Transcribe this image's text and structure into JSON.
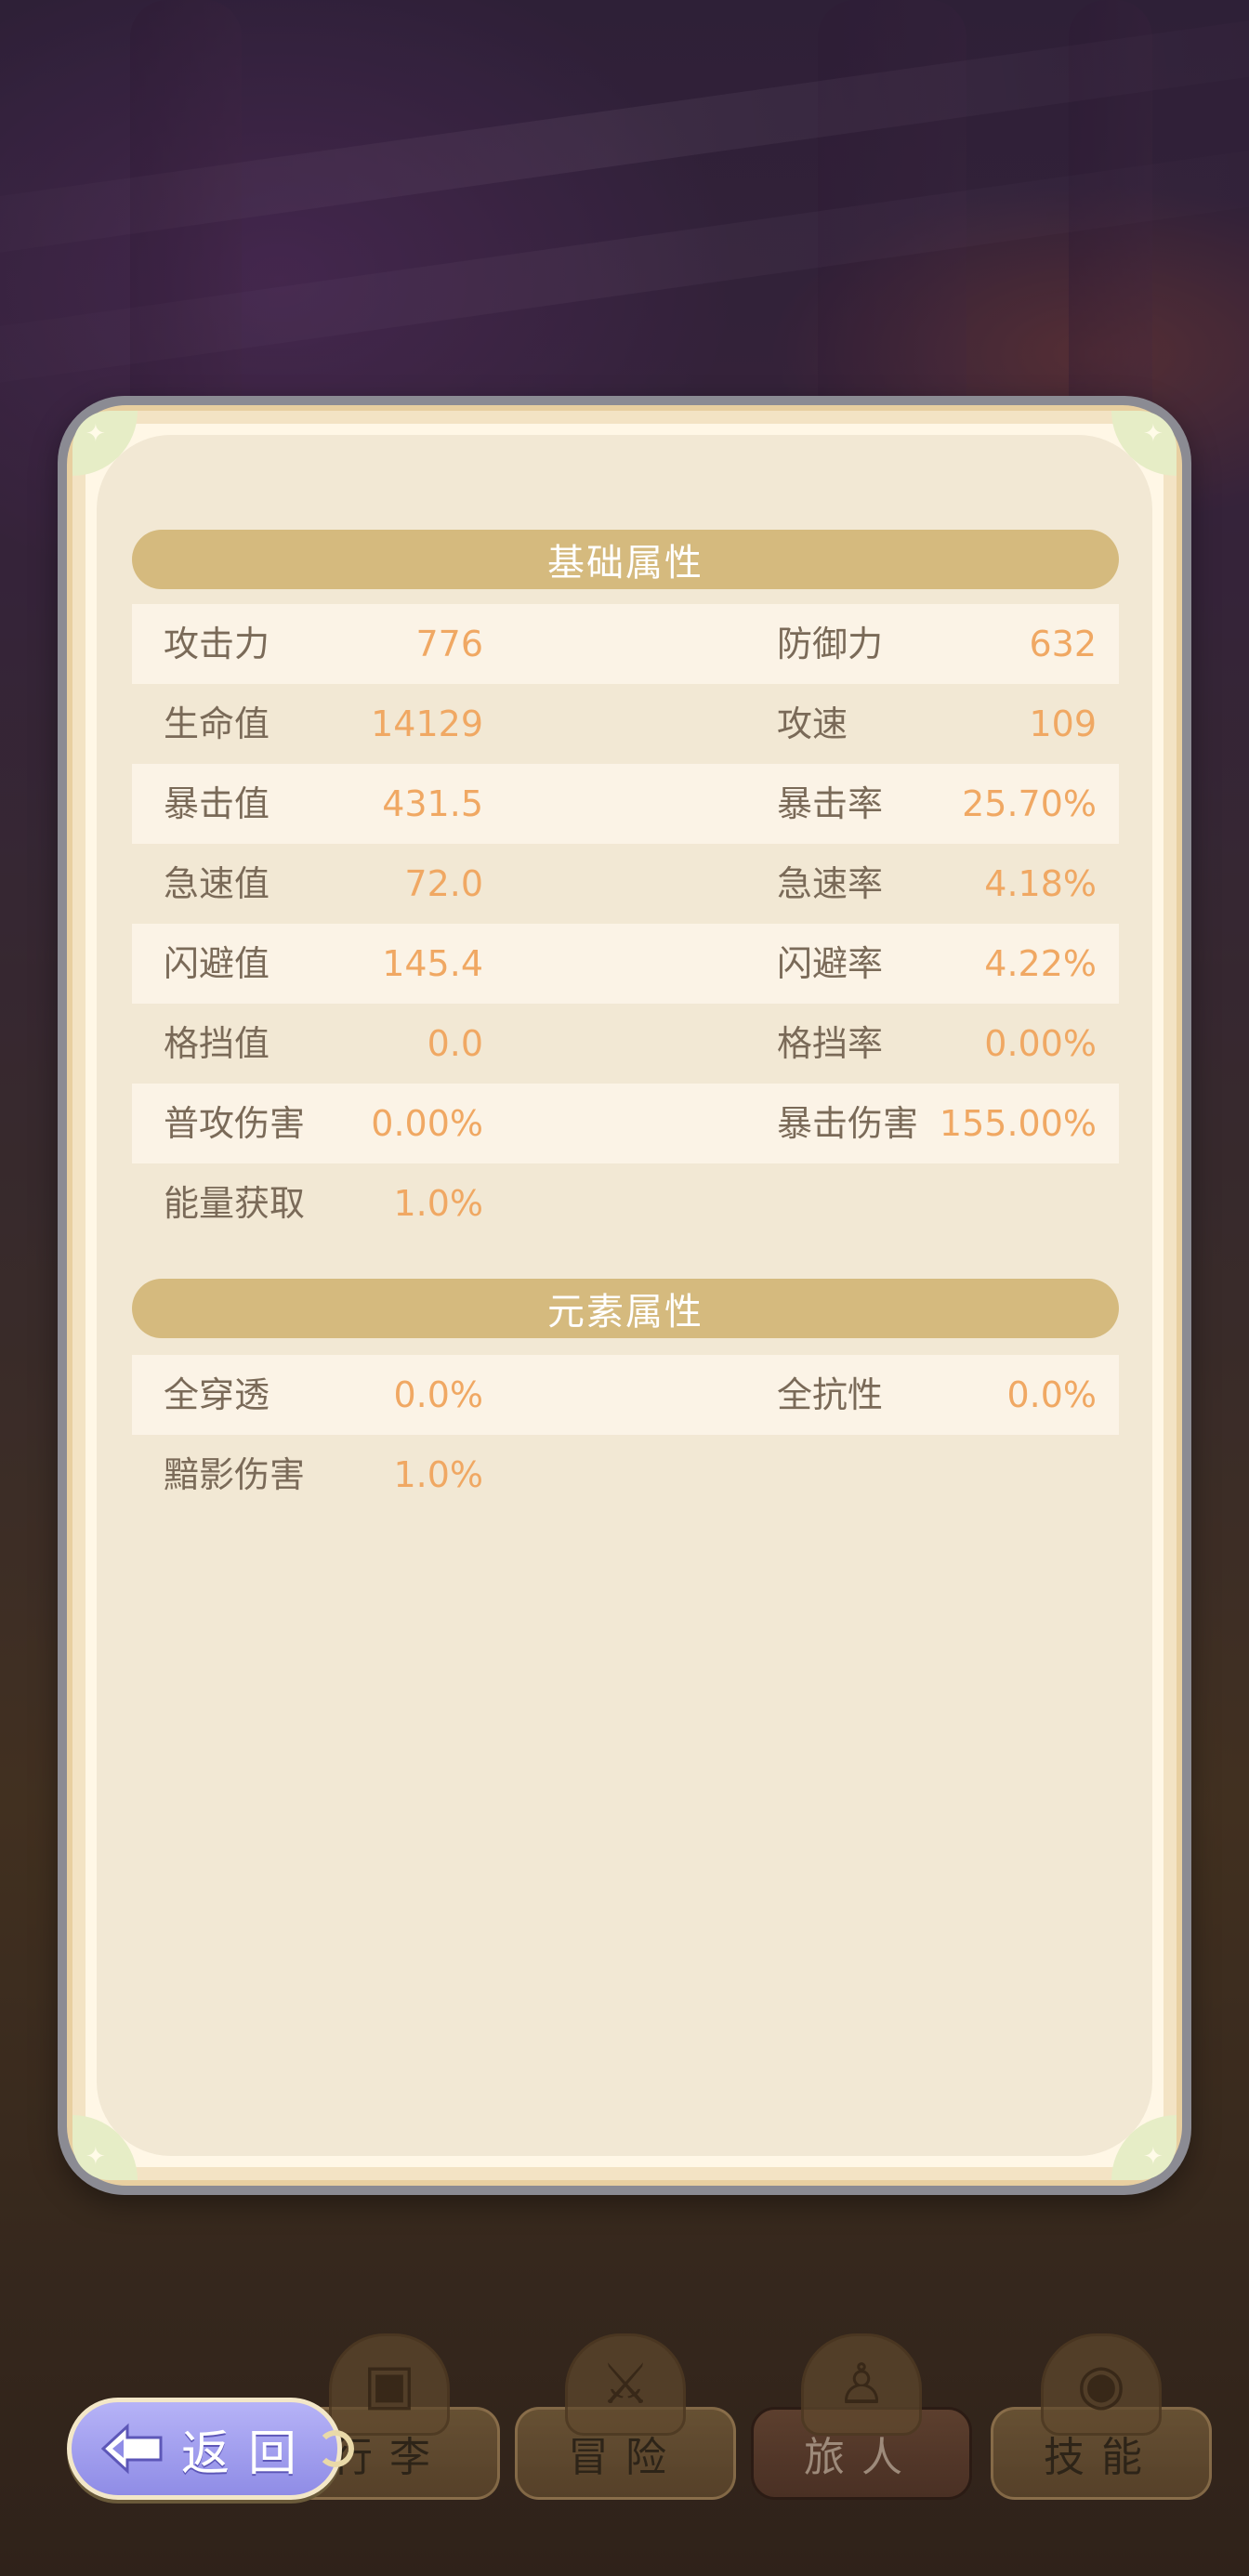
{
  "panel": {
    "sections": [
      {
        "title": "基础属性",
        "rows": [
          {
            "label1": "攻击力",
            "value1": "776",
            "label2": "防御力",
            "value2": "632"
          },
          {
            "label1": "生命值",
            "value1": "14129",
            "label2": "攻速",
            "value2": "109"
          },
          {
            "label1": "暴击值",
            "value1": "431.5",
            "label2": "暴击率",
            "value2": "25.70%"
          },
          {
            "label1": "急速值",
            "value1": "72.0",
            "label2": "急速率",
            "value2": "4.18%"
          },
          {
            "label1": "闪避值",
            "value1": "145.4",
            "label2": "闪避率",
            "value2": "4.22%"
          },
          {
            "label1": "格挡值",
            "value1": "0.0",
            "label2": "格挡率",
            "value2": "0.00%"
          },
          {
            "label1": "普攻伤害",
            "value1": "0.00%",
            "label2": "暴击伤害",
            "value2": "155.00%"
          },
          {
            "label1": "能量获取",
            "value1": "1.0%",
            "label2": "",
            "value2": ""
          }
        ]
      },
      {
        "title": "元素属性",
        "rows": [
          {
            "label1": "全穿透",
            "value1": "0.0%",
            "label2": "全抗性",
            "value2": "0.0%"
          },
          {
            "label1": "黯影伤害",
            "value1": "1.0%",
            "label2": "",
            "value2": ""
          }
        ]
      }
    ]
  },
  "bottom_nav": {
    "tabs": [
      {
        "label": "行李",
        "icon": "chest-icon"
      },
      {
        "label": "冒险",
        "icon": "crossed-swords-icon"
      },
      {
        "label": "旅人",
        "icon": "hooded-figure-icon",
        "active": true
      },
      {
        "label": "技能",
        "icon": "eye-sigil-icon"
      }
    ]
  },
  "return_button": {
    "label": "返回",
    "icon": "back-arrow-icon"
  },
  "colors": {
    "section_header": "#d5ba7e",
    "stat_label": "#7a6a58",
    "stat_value": "#f0a863",
    "return_button": "#a6a3f2"
  }
}
